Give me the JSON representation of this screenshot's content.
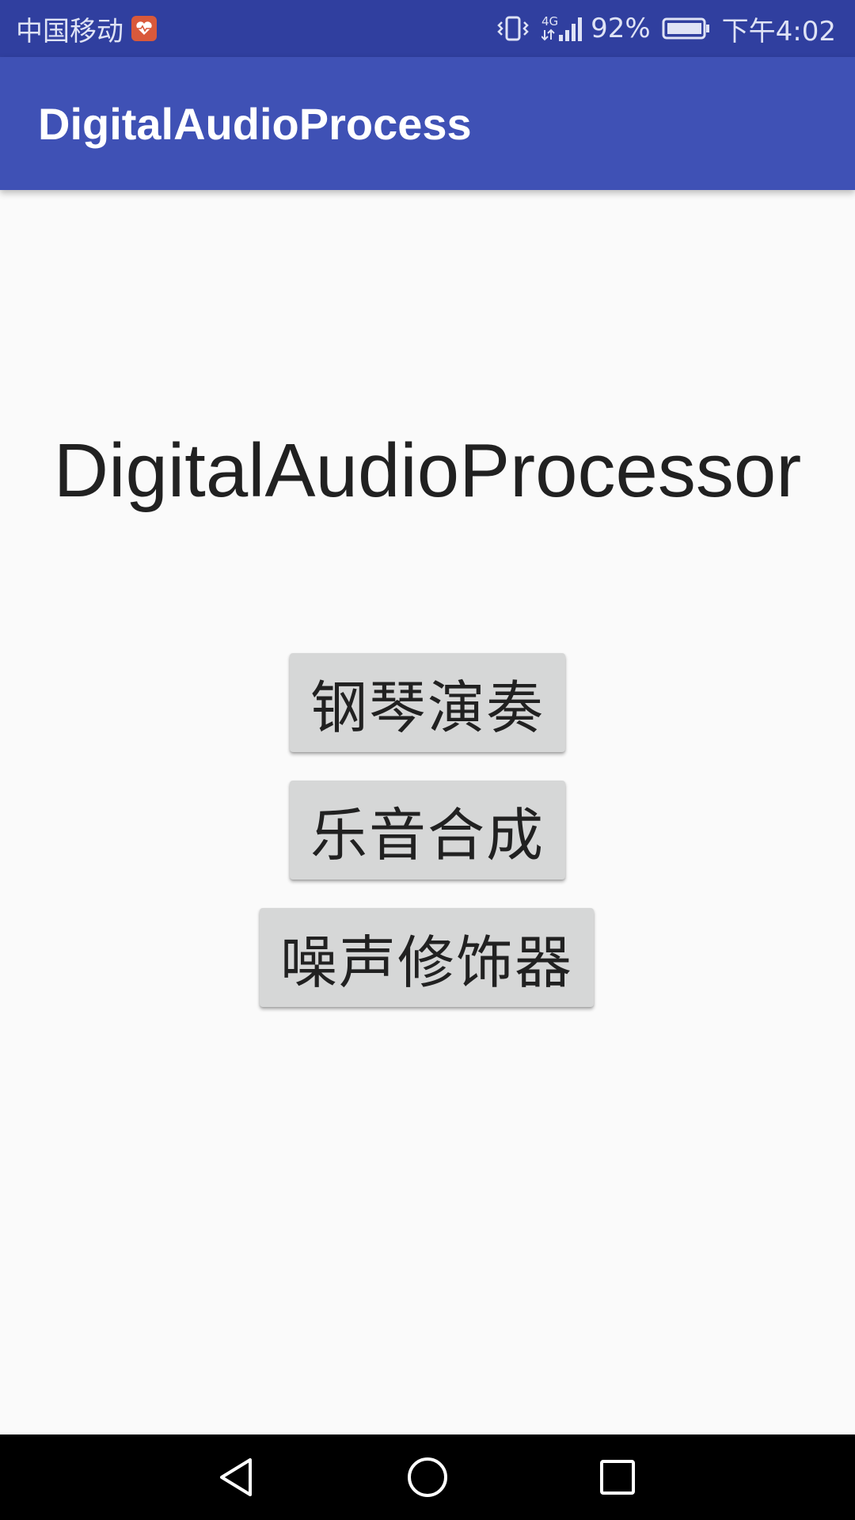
{
  "status_bar": {
    "carrier": "中国移动",
    "network": "4G",
    "battery_percent": "92%",
    "time": "下午4:02",
    "icons": [
      "health-app-icon",
      "vibrate-icon",
      "signal-icon",
      "battery-icon"
    ]
  },
  "app_bar": {
    "title": "DigitalAudioProcess"
  },
  "main": {
    "heading": "DigitalAudioProcessor",
    "buttons": [
      {
        "label": "钢琴演奏"
      },
      {
        "label": "乐音合成"
      },
      {
        "label": "噪声修饰器"
      }
    ]
  },
  "nav_bar": {
    "icons": [
      "back-icon",
      "home-icon",
      "recent-apps-icon"
    ]
  },
  "colors": {
    "status_bar": "#303f9f",
    "app_bar": "#3f51b5",
    "background": "#fafafa",
    "button": "#d6d7d7",
    "nav_bar": "#000000"
  }
}
